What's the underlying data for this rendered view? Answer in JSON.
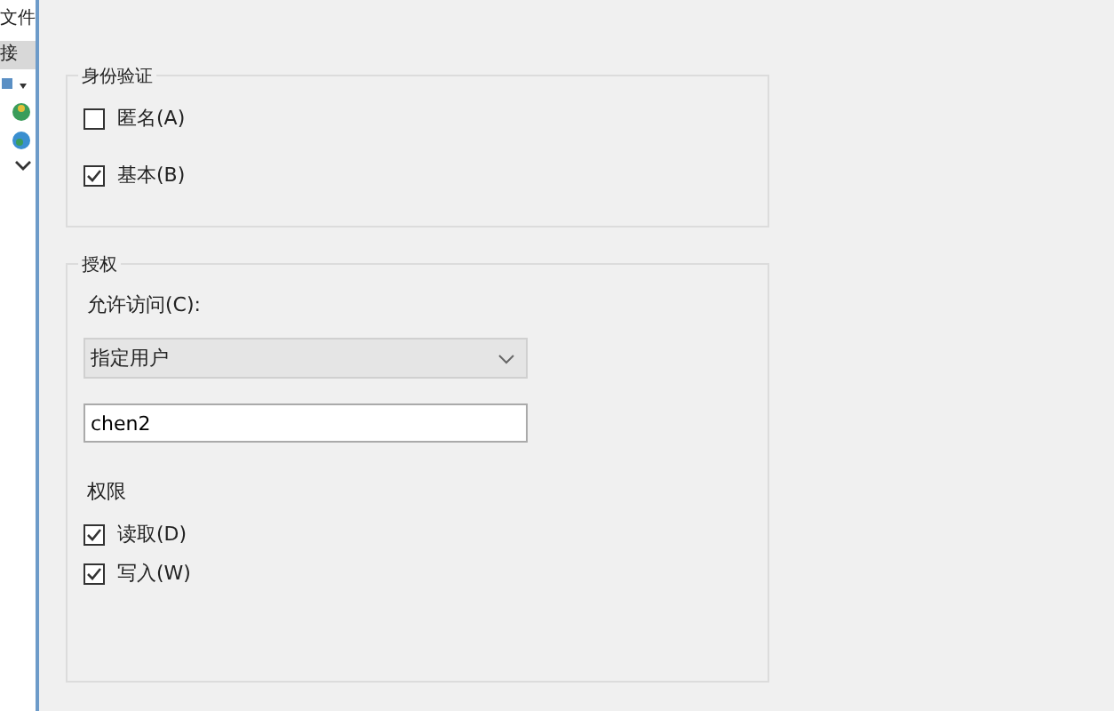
{
  "background_window": {
    "menu": [
      "文件",
      "接"
    ]
  },
  "authentication": {
    "title": "身份验证",
    "options": [
      {
        "label": "匿名(A)",
        "checked": false
      },
      {
        "label": "基本(B)",
        "checked": true
      }
    ]
  },
  "authorization": {
    "title": "授权",
    "access_label": "允许访问(C):",
    "access_value": "指定用户",
    "user_value": "chen2",
    "permissions_title": "权限",
    "permissions": [
      {
        "label": "读取(D)",
        "checked": true
      },
      {
        "label": "写入(W)",
        "checked": true
      }
    ]
  }
}
